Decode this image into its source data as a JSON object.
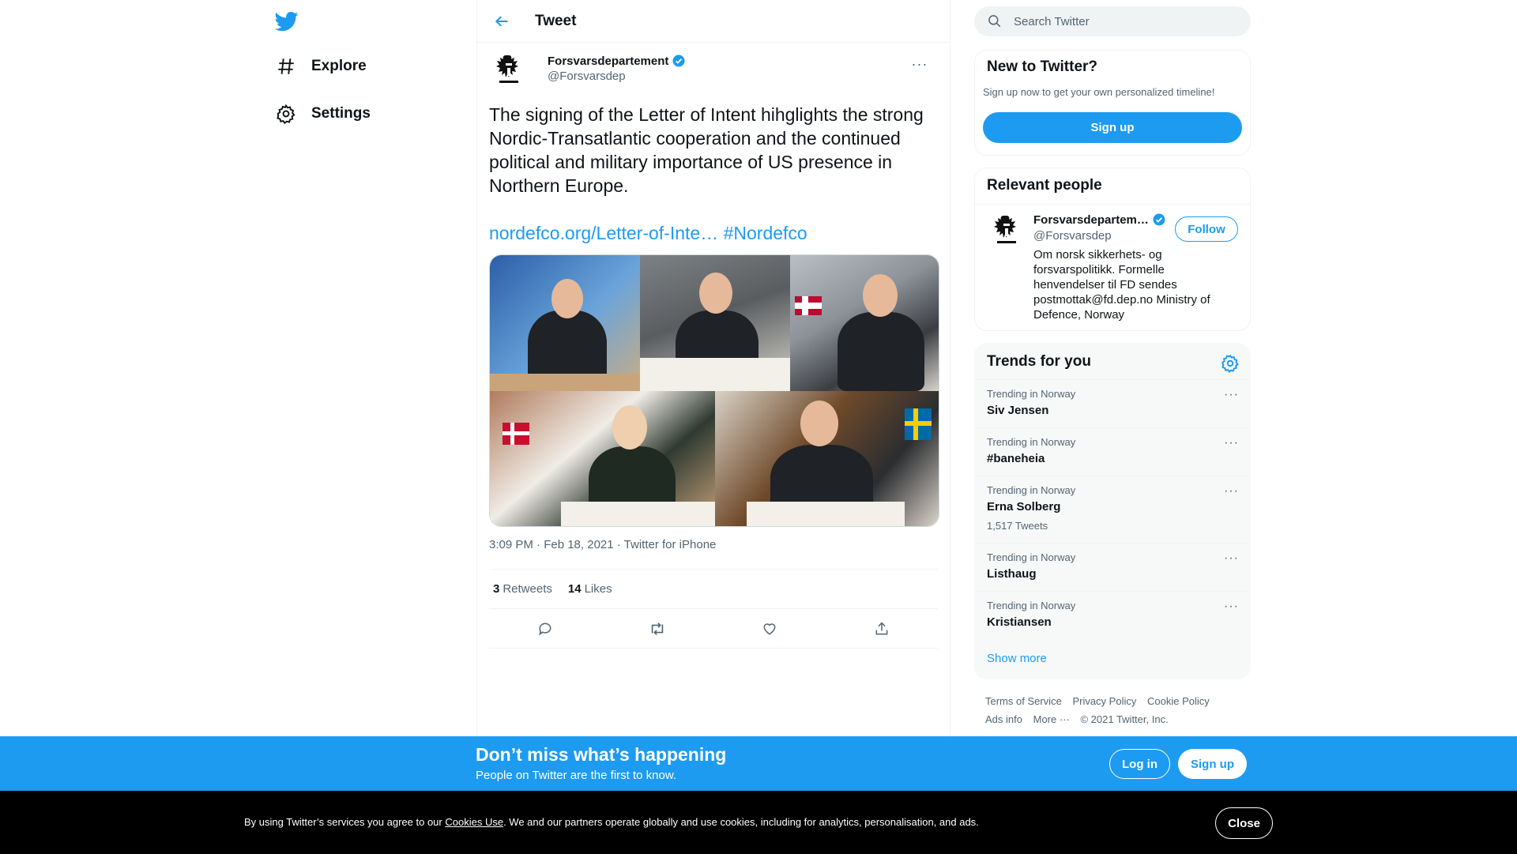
{
  "nav": {
    "logo_icon": "twitter-bird-icon",
    "items": [
      {
        "label": "Explore",
        "icon": "hashtag-icon"
      },
      {
        "label": "Settings",
        "icon": "gear-icon"
      }
    ]
  },
  "header": {
    "title": "Tweet",
    "back_icon": "arrow-left-icon"
  },
  "tweet": {
    "author_name": "Forsvarsdepartement",
    "author_handle": "@Forsvarsdep",
    "verified": true,
    "text": "The signing of the Letter of Intent hihglights the strong Nordic-Transatlantic cooperation and the continued political and military importance of US presence in Northern Europe.",
    "link": "nordefco.org/Letter-of-Inte…",
    "hashtag": "#Nordefco",
    "meta": "3:09 PM · Feb 18, 2021 · Twitter for iPhone",
    "retweets_count": "3",
    "retweets_label": "Retweets",
    "likes_count": "14",
    "likes_label": "Likes",
    "more_label": "···"
  },
  "search": {
    "placeholder": "Search Twitter"
  },
  "new_to_twitter": {
    "title": "New to Twitter?",
    "subtitle": "Sign up now to get your own personalized timeline!",
    "button": "Sign up"
  },
  "relevant_people": {
    "title": "Relevant people",
    "name": "Forsvarsdepartem…",
    "handle": "@Forsvarsdep",
    "follow": "Follow",
    "bio": "Om norsk sikkerhets- og forsvarspolitikk. Formelle henvendelser til FD sendes postmottak@fd.dep.no Ministry of Defence, Norway"
  },
  "trends": {
    "title": "Trends for you",
    "items": [
      {
        "context": "Trending in Norway",
        "name": "Siv Jensen",
        "count": ""
      },
      {
        "context": "Trending in Norway",
        "name": "#baneheia",
        "count": ""
      },
      {
        "context": "Trending in Norway",
        "name": "Erna Solberg",
        "count": "1,517 Tweets"
      },
      {
        "context": "Trending in Norway",
        "name": "Listhaug",
        "count": ""
      },
      {
        "context": "Trending in Norway",
        "name": "Kristiansen",
        "count": ""
      }
    ],
    "more_label": "···",
    "show_more": "Show more"
  },
  "footer": {
    "terms": "Terms of Service",
    "privacy": "Privacy Policy",
    "cookie": "Cookie Policy",
    "ads": "Ads info",
    "more": "More ···",
    "copyright": "© 2021 Twitter, Inc."
  },
  "banner": {
    "title": "Don’t miss what’s happening",
    "subtitle": "People on Twitter are the first to know.",
    "login": "Log in",
    "signup": "Sign up"
  },
  "cookie": {
    "text_before": "By using Twitter’s services you agree to our ",
    "link": "Cookies Use",
    "text_after": ". We and our partners operate globally and use cookies, including for analytics, personalisation, and ads.",
    "close": "Close"
  },
  "colors": {
    "accent": "#1d9bf0",
    "text": "#0f1419",
    "muted": "#536471",
    "cookie_bg": "#000000"
  }
}
